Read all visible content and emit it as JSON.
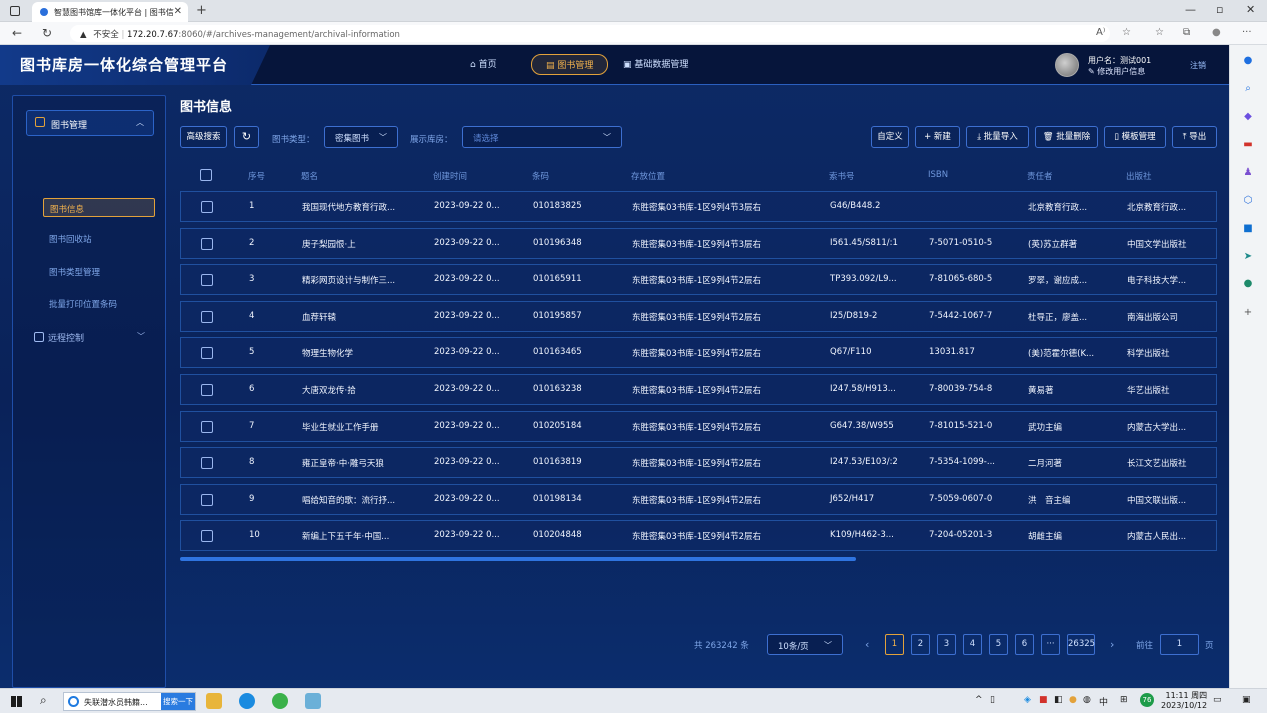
{
  "browser": {
    "tab_title": "智慧图书馆库一体化平台 | 图书信",
    "tab_close": "✕",
    "new_tab": "+",
    "back": "←",
    "refresh": "↻",
    "insecure_label": "不安全",
    "url_host": "172.20.7.67",
    "url_rest": ":8060/#/archives-management/archival-information",
    "read_aloud": "A⁾",
    "favorite": "☆",
    "collections": "⧉",
    "profile": "●",
    "menu": "···",
    "win_min": "—",
    "win_max": "▫",
    "win_close": "✕"
  },
  "header": {
    "brand": "图书库房一体化综合管理平台",
    "nav": [
      {
        "label": "⌂ 首页"
      },
      {
        "label": "▤ 图书管理"
      },
      {
        "label": "▣ 基础数据管理"
      }
    ],
    "user_name": "用户名：测试001",
    "edit_user": "✎ 修改用户信息",
    "logout": "注销"
  },
  "sidebar": {
    "group_label": "图书管理",
    "group_chevron": "︿",
    "items": [
      {
        "label": "图书信息"
      },
      {
        "label": "图书回收站"
      },
      {
        "label": "图书类型管理"
      },
      {
        "label": "批量打印位置条码"
      }
    ],
    "remote_label": "远程控制",
    "remote_chevron": "﹀"
  },
  "main": {
    "title": "图书信息",
    "advanced_search": "高级搜索",
    "refresh_icon": "↻",
    "book_type_label": "图书类型：",
    "book_type_value": "密集图书",
    "warehouse_label": "展示库房：",
    "warehouse_placeholder": "请选择",
    "chevron": "﹀",
    "actions": {
      "customize": "自定义",
      "new": "+ 新建",
      "import": "⤓ 批量导入",
      "delete": "🗑 批量删除",
      "template": "▯ 模板管理",
      "export": "⤒ 导出"
    }
  },
  "table": {
    "columns": [
      "序号",
      "题名",
      "创建时间",
      "条码",
      "存放位置",
      "索书号",
      "ISBN",
      "责任者",
      "出版社"
    ],
    "rows": [
      [
        "1",
        "我国现代地方教育行政...",
        "2023-09-22 0...",
        "010183825",
        "东胜密集03书库-1区9列4节3层右",
        "G46/B448.2",
        "",
        "北京教育行政...",
        "北京教育行政..."
      ],
      [
        "2",
        "庚子梨园恨·上",
        "2023-09-22 0...",
        "010196348",
        "东胜密集03书库-1区9列4节3层右",
        "I561.45/S811/:1",
        "7-5071-0510-5",
        "(英)苏立群著",
        "中国文学出版社"
      ],
      [
        "3",
        "精彩网页设计与制作三...",
        "2023-09-22 0...",
        "010165911",
        "东胜密集03书库-1区9列4节2层右",
        "TP393.092/L9...",
        "7-81065-680-5",
        "罗翠，谢应成...",
        "电子科技大学..."
      ],
      [
        "4",
        "血荐轩辕",
        "2023-09-22 0...",
        "010195857",
        "东胜密集03书库-1区9列4节2层右",
        "I25/D819-2",
        "7-5442-1067-7",
        "杜导正，廖盖...",
        "南海出版公司"
      ],
      [
        "5",
        "物理生物化学",
        "2023-09-22 0...",
        "010163465",
        "东胜密集03书库-1区9列4节2层右",
        "Q67/F110",
        "13031.817",
        "(美)范霍尔德(K...",
        "科学出版社"
      ],
      [
        "6",
        "大唐双龙传·拾",
        "2023-09-22 0...",
        "010163238",
        "东胜密集03书库-1区9列4节2层右",
        "I247.58/H913...",
        "7-80039-754-8",
        "黄易著",
        "华艺出版社"
      ],
      [
        "7",
        "毕业生就业工作手册",
        "2023-09-22 0...",
        "010205184",
        "东胜密集03书库-1区9列4节2层右",
        "G647.38/W955",
        "7-81015-521-0",
        "武功主编",
        "内蒙古大学出..."
      ],
      [
        "8",
        "雍正皇帝·中·雕弓天狼",
        "2023-09-22 0...",
        "010163819",
        "东胜密集03书库-1区9列4节2层右",
        "I247.53/E103/:2",
        "7-5354-1099-...",
        "二月河著",
        "长江文艺出版社"
      ],
      [
        "9",
        "唱给知音的歌：流行抒...",
        "2023-09-22 0...",
        "010198134",
        "东胜密集03书库-1区9列4节2层右",
        "J652/H417",
        "7-5059-0607-0",
        "洪　音主编",
        "中国文联出版..."
      ],
      [
        "10",
        "新编上下五千年·中国...",
        "2023-09-22 0...",
        "010204848",
        "东胜密集03书库-1区9列4节2层右",
        "K109/H462-3...",
        "7-204-05201-3",
        "胡雌主编",
        "内蒙古人民出..."
      ]
    ]
  },
  "pagination": {
    "total": "共 263242 条",
    "page_size": "10条/页",
    "prev": "‹",
    "pages": [
      "1",
      "2",
      "3",
      "4",
      "5",
      "6",
      "···",
      "26325"
    ],
    "next": "›",
    "goto_label": "前往",
    "goto_value": "1",
    "page_unit": "页"
  },
  "taskbar": {
    "search_text": "失联潜水员韩籍...",
    "search_button": "搜索一下",
    "ime": "中",
    "time": "11:11 周四",
    "date": "2023/10/12",
    "badge": "76"
  }
}
